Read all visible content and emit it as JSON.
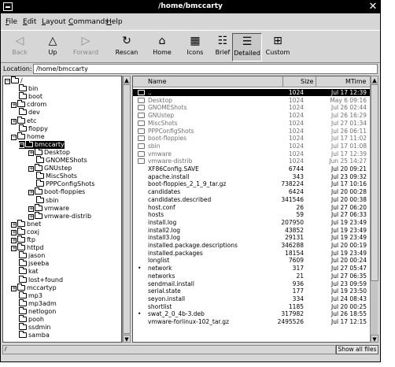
{
  "window": {
    "title": "/home/bmccarty",
    "close_glyph": "✕"
  },
  "menubar": [
    "File",
    "Edit",
    "Layout",
    "Commands",
    "Help"
  ],
  "toolbar": [
    {
      "label": "Back",
      "icon": "◁",
      "state": "disabled"
    },
    {
      "label": "Up",
      "icon": "△",
      "state": "normal"
    },
    {
      "label": "Forward",
      "icon": "▷",
      "state": "disabled"
    },
    {
      "label": "Rescan",
      "icon": "↻",
      "state": "normal"
    },
    {
      "label": "Home",
      "icon": "⌂",
      "state": "normal"
    },
    {
      "label": "Icons",
      "icon": "▦",
      "state": "normal"
    },
    {
      "label": "Brief",
      "icon": "☷",
      "state": "normal"
    },
    {
      "label": "Detailed",
      "icon": "☰",
      "state": "active"
    },
    {
      "label": "Custom",
      "icon": "⊞",
      "state": "normal"
    }
  ],
  "location": {
    "label": "Location:",
    "value": "/home/bmccarty"
  },
  "tree": [
    {
      "label": "/",
      "depth": 0,
      "exp": "-",
      "open": true
    },
    {
      "label": "bin",
      "depth": 1,
      "exp": ""
    },
    {
      "label": "boot",
      "depth": 1,
      "exp": ""
    },
    {
      "label": "cdrom",
      "depth": 1,
      "exp": "+"
    },
    {
      "label": "dev",
      "depth": 1,
      "exp": ""
    },
    {
      "label": "etc",
      "depth": 1,
      "exp": "+"
    },
    {
      "label": "floppy",
      "depth": 1,
      "exp": ""
    },
    {
      "label": "home",
      "depth": 1,
      "exp": "-",
      "open": true
    },
    {
      "label": "bmccarty",
      "depth": 2,
      "exp": "-",
      "open": true,
      "selected": true
    },
    {
      "label": "Desktop",
      "depth": 3,
      "exp": "+"
    },
    {
      "label": "GNOMEShots",
      "depth": 3,
      "exp": ""
    },
    {
      "label": "GNUstep",
      "depth": 3,
      "exp": "+"
    },
    {
      "label": "MiscShots",
      "depth": 3,
      "exp": ""
    },
    {
      "label": "PPPConfigShots",
      "depth": 3,
      "exp": ""
    },
    {
      "label": "boot-floppies",
      "depth": 3,
      "exp": "+"
    },
    {
      "label": "sbin",
      "depth": 3,
      "exp": ""
    },
    {
      "label": "vmware",
      "depth": 3,
      "exp": "+"
    },
    {
      "label": "vmware-distrib",
      "depth": 3,
      "exp": "+"
    },
    {
      "label": "bnet",
      "depth": 1,
      "exp": "+"
    },
    {
      "label": "coxj",
      "depth": 1,
      "exp": "+"
    },
    {
      "label": "ftp",
      "depth": 1,
      "exp": "+"
    },
    {
      "label": "httpd",
      "depth": 1,
      "exp": "+"
    },
    {
      "label": "jason",
      "depth": 1,
      "exp": ""
    },
    {
      "label": "jseeba",
      "depth": 1,
      "exp": ""
    },
    {
      "label": "kat",
      "depth": 1,
      "exp": ""
    },
    {
      "label": "lost+found",
      "depth": 1,
      "exp": ""
    },
    {
      "label": "mccartyp",
      "depth": 1,
      "exp": "+"
    },
    {
      "label": "mp3",
      "depth": 1,
      "exp": ""
    },
    {
      "label": "mp3adm",
      "depth": 1,
      "exp": ""
    },
    {
      "label": "netlogon",
      "depth": 1,
      "exp": ""
    },
    {
      "label": "pooh",
      "depth": 1,
      "exp": ""
    },
    {
      "label": "ssdmin",
      "depth": 1,
      "exp": ""
    },
    {
      "label": "samba",
      "depth": 1,
      "exp": ""
    }
  ],
  "list": {
    "headers": {
      "name": "Name",
      "size": "Size",
      "mtime": "MTime"
    },
    "rows": [
      {
        "name": "..",
        "size": "1024",
        "mtime": "Jul 17 12:39",
        "type": "dir",
        "selected": true
      },
      {
        "name": "Desktop",
        "size": "1024",
        "mtime": "May  6 09:16",
        "type": "dir"
      },
      {
        "name": "GNOMEShots",
        "size": "1024",
        "mtime": "Jul 26 02:44",
        "type": "dir"
      },
      {
        "name": "GNUstep",
        "size": "1024",
        "mtime": "Jul 26 16:29",
        "type": "dir"
      },
      {
        "name": "MiscShots",
        "size": "1024",
        "mtime": "Jul 27 01:34",
        "type": "dir"
      },
      {
        "name": "PPPConfigShots",
        "size": "1024",
        "mtime": "Jul 26 06:11",
        "type": "dir"
      },
      {
        "name": "boot-floppies",
        "size": "1024",
        "mtime": "Jul 17 11:02",
        "type": "dir"
      },
      {
        "name": "sbin",
        "size": "1024",
        "mtime": "Jul 17 01:08",
        "type": "dir"
      },
      {
        "name": "vmware",
        "size": "1024",
        "mtime": "Jul 17 12:39",
        "type": "dir"
      },
      {
        "name": "vmware-distrib",
        "size": "1024",
        "mtime": "Jun 25 14:27",
        "type": "dir"
      },
      {
        "name": "XF86Config.SAVE",
        "size": "6744",
        "mtime": "Jul 20 09:21",
        "type": "file"
      },
      {
        "name": "apache.install",
        "size": "343",
        "mtime": "Jul 23 09:32",
        "type": "file"
      },
      {
        "name": "boot-floppies_2_1_9_tar.gz",
        "size": "738224",
        "mtime": "Jul 17 10:16",
        "type": "file"
      },
      {
        "name": "candidates",
        "size": "6424",
        "mtime": "Jul 20 00:28",
        "type": "file"
      },
      {
        "name": "candidates.described",
        "size": "341546",
        "mtime": "Jul 20 00:38",
        "type": "file"
      },
      {
        "name": "host.conf",
        "size": "26",
        "mtime": "Jul 27 06:20",
        "type": "file"
      },
      {
        "name": "hosts",
        "size": "59",
        "mtime": "Jul 27 06:33",
        "type": "file"
      },
      {
        "name": "install.log",
        "size": "207950",
        "mtime": "Jul 19 23:49",
        "type": "file"
      },
      {
        "name": "install2.log",
        "size": "43852",
        "mtime": "Jul 19 23:49",
        "type": "file"
      },
      {
        "name": "install3.log",
        "size": "29131",
        "mtime": "Jul 19 23:49",
        "type": "file"
      },
      {
        "name": "installed.package.descriptions",
        "size": "346288",
        "mtime": "Jul 20 00:19",
        "type": "file"
      },
      {
        "name": "installed.packages",
        "size": "18154",
        "mtime": "Jul 19 23:49",
        "type": "file"
      },
      {
        "name": "longlist",
        "size": "7609",
        "mtime": "Jul 20 00:24",
        "type": "file"
      },
      {
        "name": "network",
        "size": "317",
        "mtime": "Jul 27 05:47",
        "type": "exec"
      },
      {
        "name": "networks",
        "size": "21",
        "mtime": "Jul 27 06:35",
        "type": "file"
      },
      {
        "name": "sendmail.install",
        "size": "936",
        "mtime": "Jul 23 09:59",
        "type": "file"
      },
      {
        "name": "serial.state",
        "size": "177",
        "mtime": "Jul 19 23:50",
        "type": "file"
      },
      {
        "name": "seyon.install",
        "size": "334",
        "mtime": "Jul 24 08:43",
        "type": "file"
      },
      {
        "name": "shortlist",
        "size": "1185",
        "mtime": "Jul 20 00:25",
        "type": "file"
      },
      {
        "name": "swat_2_0_4b-3.deb",
        "size": "317982",
        "mtime": "Jul 26 18:55",
        "type": "exec"
      },
      {
        "name": "vmware-forlinux-102_tar.gz",
        "size": "2495526",
        "mtime": "Jul 17 12:15",
        "type": "file"
      }
    ]
  },
  "status": {
    "message": "/",
    "show_all_label": "Show all files"
  }
}
